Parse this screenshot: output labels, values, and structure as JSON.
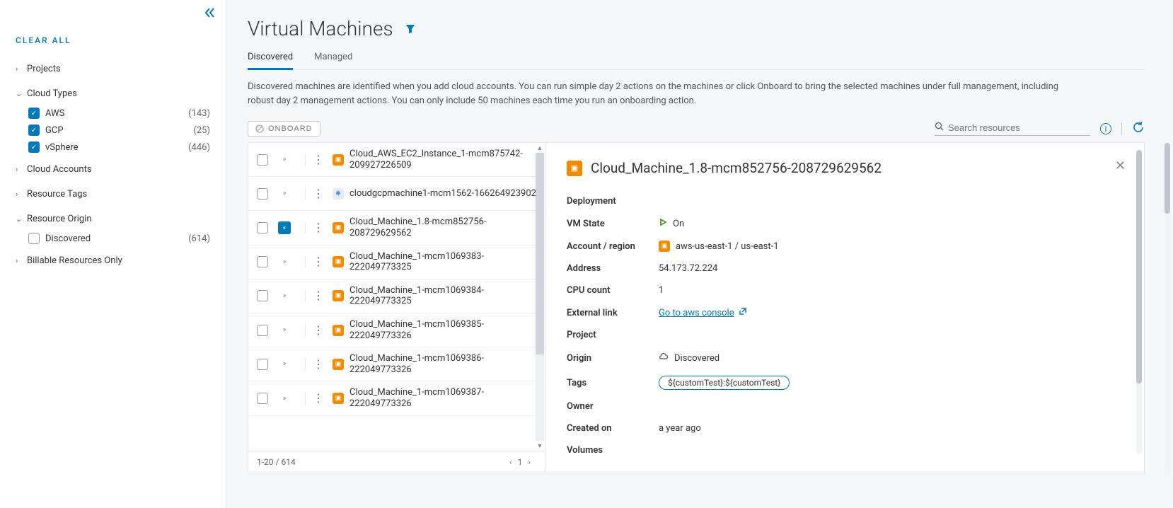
{
  "sidebar": {
    "clear_all": "CLEAR ALL",
    "groups": [
      {
        "title": "Projects",
        "expanded": false
      },
      {
        "title": "Cloud Types",
        "expanded": true,
        "items": [
          {
            "label": "AWS",
            "count": "(143)",
            "checked": true
          },
          {
            "label": "GCP",
            "count": "(25)",
            "checked": true
          },
          {
            "label": "vSphere",
            "count": "(446)",
            "checked": true
          }
        ]
      },
      {
        "title": "Cloud Accounts",
        "expanded": false
      },
      {
        "title": "Resource Tags",
        "expanded": false
      },
      {
        "title": "Resource Origin",
        "expanded": true,
        "items": [
          {
            "label": "Discovered",
            "count": "(614)",
            "checked": false
          }
        ]
      },
      {
        "title": "Billable Resources Only",
        "expanded": false
      }
    ]
  },
  "header": {
    "title": "Virtual Machines",
    "tabs": [
      {
        "label": "Discovered",
        "active": true
      },
      {
        "label": "Managed",
        "active": false
      }
    ],
    "description": "Discovered machines are identified when you add cloud accounts. You can run simple day 2 actions on the machines or click Onboard to bring the selected machines under full management, including robust day 2 management actions. You can only include 50 machines each time you run an onboarding action."
  },
  "toolbar": {
    "onboard_label": "ONBOARD",
    "search_placeholder": "Search resources"
  },
  "table": {
    "rows": [
      {
        "name": "Cloud_AWS_EC2_Instance_1-mcm875742-209927226509",
        "icon": "aws"
      },
      {
        "name": "cloudgcpmachine1-mcm1562-166264923902",
        "icon": "gcp"
      },
      {
        "name": "Cloud_Machine_1.8-mcm852756-208729629562",
        "icon": "aws",
        "selected": true
      },
      {
        "name": "Cloud_Machine_1-mcm1069383-222049773325",
        "icon": "aws"
      },
      {
        "name": "Cloud_Machine_1-mcm1069384-222049773325",
        "icon": "aws"
      },
      {
        "name": "Cloud_Machine_1-mcm1069385-222049773326",
        "icon": "aws"
      },
      {
        "name": "Cloud_Machine_1-mcm1069386-222049773326",
        "icon": "aws"
      },
      {
        "name": "Cloud_Machine_1-mcm1069387-222049773326",
        "icon": "aws"
      }
    ],
    "footer": {
      "range": "1-20 / 614",
      "page": "1"
    }
  },
  "detail": {
    "name": "Cloud_Machine_1.8-mcm852756-208729629562",
    "deployment_label": "Deployment",
    "sections": [
      {
        "label": "VM State",
        "value": "On",
        "icon": "on"
      },
      {
        "label": "Account / region",
        "value": "aws-us-east-1 / us-east-1",
        "icon": "acct"
      },
      {
        "label": "Address",
        "value": "54.173.72.224"
      },
      {
        "label": "CPU count",
        "value": "1"
      },
      {
        "label": "External link",
        "value": "Go to aws console",
        "link": true
      },
      {
        "label": "Project",
        "value": ""
      },
      {
        "label": "Origin",
        "value": "Discovered",
        "icon": "cloud"
      },
      {
        "label": "Tags",
        "value": "${customTest}:${customTest}",
        "tag": true
      },
      {
        "label": "Owner",
        "value": ""
      },
      {
        "label": "Created on",
        "value": "a year ago"
      },
      {
        "label": "Volumes",
        "value": ""
      }
    ]
  }
}
